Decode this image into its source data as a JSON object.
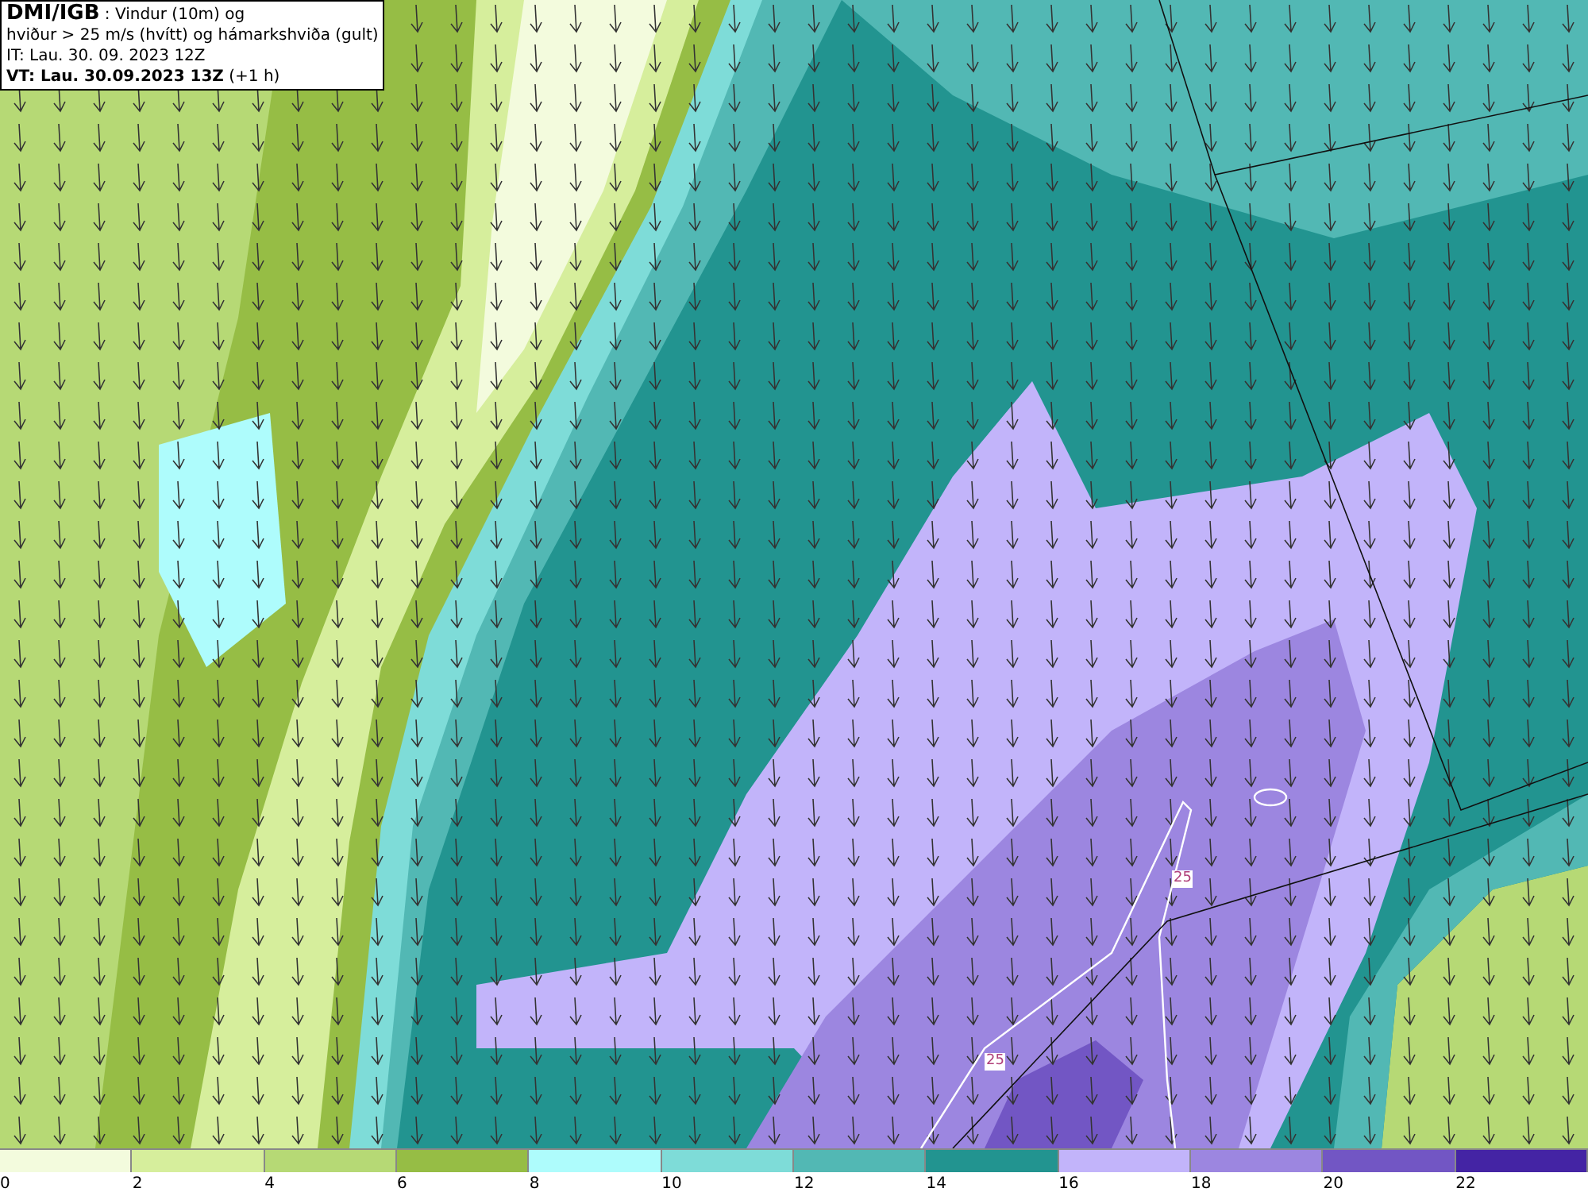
{
  "title_box": {
    "source": "DMI/IGB",
    "title_rest": " : Vindur (10m) og",
    "line_2": "hviður > 25 m/s (hvítt) og hámarkshviða (gult)",
    "init_time": "IT: Lau. 30. 09. 2023 12Z",
    "valid_time": "VT: Lau. 30.09.2023 13Z",
    "valid_offset": " (+1 h)"
  },
  "contour_labels": [
    "25",
    "25"
  ],
  "legend": {
    "swatches": [
      {
        "color": "#f3fbdd"
      },
      {
        "color": "#d6ee9c"
      },
      {
        "color": "#b6d975"
      },
      {
        "color": "#96bd45"
      },
      {
        "color": "#aefcfc"
      },
      {
        "color": "#7edcd8"
      },
      {
        "color": "#52b8b4"
      },
      {
        "color": "#229490"
      },
      {
        "color": "#c2b4fa"
      },
      {
        "color": "#9c86e0"
      },
      {
        "color": "#7256c4"
      },
      {
        "color": "#4424a4"
      }
    ],
    "ticks": [
      "0",
      "2",
      "4",
      "6",
      "8",
      "10",
      "12",
      "14",
      "16",
      "18",
      "20",
      "22"
    ]
  }
}
